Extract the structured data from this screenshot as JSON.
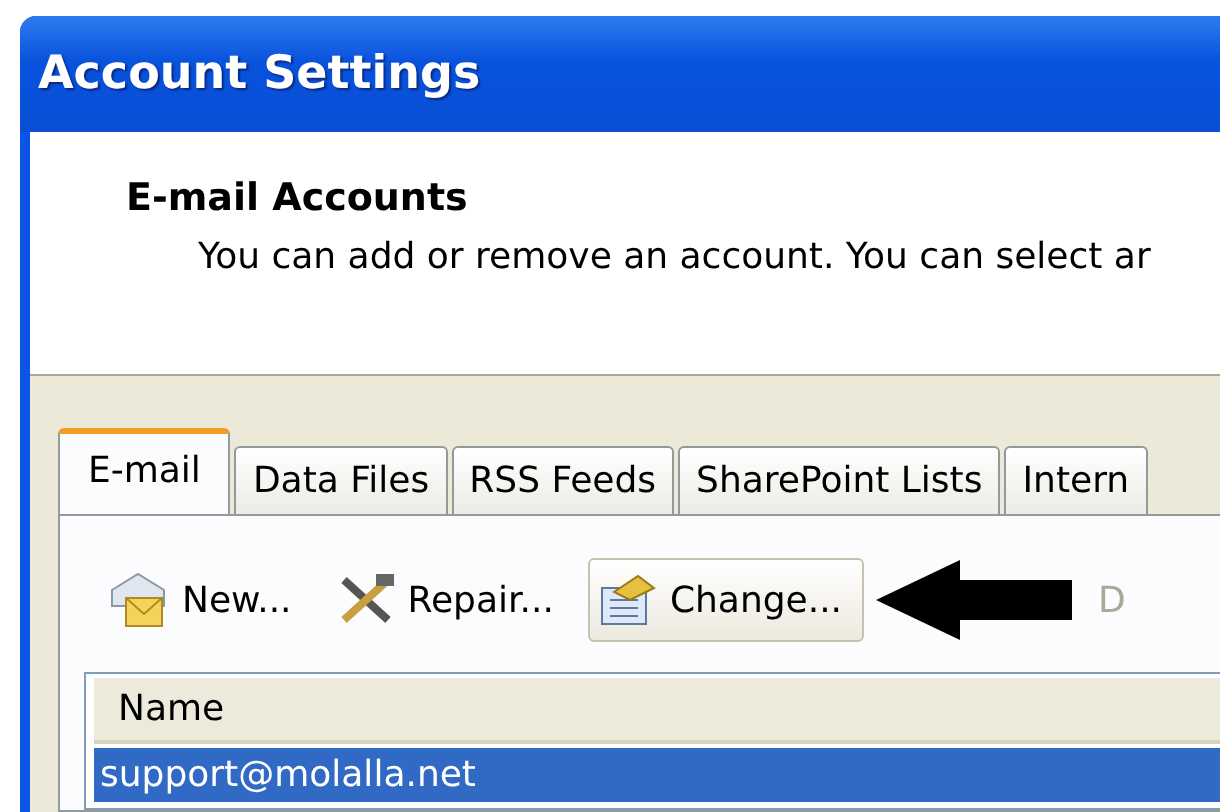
{
  "window": {
    "title": "Account Settings"
  },
  "header": {
    "title": "E-mail Accounts",
    "description": "You can add or remove an account. You can select ar"
  },
  "tabs": [
    {
      "label": "E-mail",
      "selected": true
    },
    {
      "label": "Data Files",
      "selected": false
    },
    {
      "label": "RSS Feeds",
      "selected": false
    },
    {
      "label": "SharePoint Lists",
      "selected": false
    },
    {
      "label": "Intern",
      "selected": false
    }
  ],
  "toolbar": [
    {
      "kind": "new",
      "label": "New...",
      "disabled": false,
      "highlighted": false
    },
    {
      "kind": "repair",
      "label": "Repair...",
      "disabled": false,
      "highlighted": false
    },
    {
      "kind": "change",
      "label": "Change...",
      "disabled": false,
      "highlighted": true
    },
    {
      "kind": "delete",
      "label": "D",
      "disabled": true,
      "highlighted": false
    }
  ],
  "table": {
    "columns": [
      "Name"
    ],
    "rows": [
      {
        "name": "support@molalla.net",
        "selected": true
      }
    ]
  }
}
